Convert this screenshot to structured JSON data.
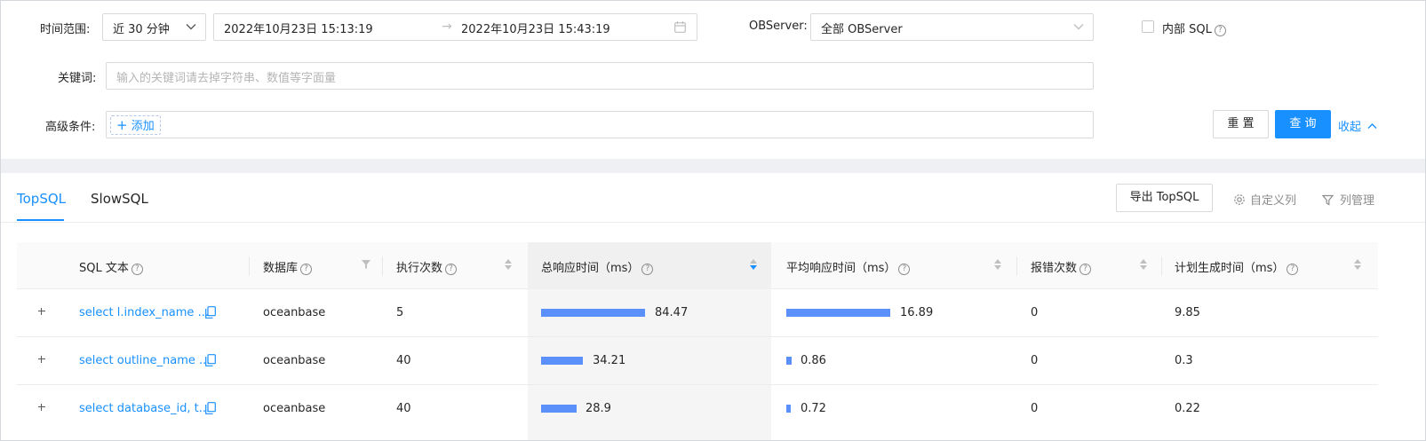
{
  "filters": {
    "time_range_label": "时间范围:",
    "time_range_value": "近 30 分钟",
    "start_time": "2022年10月23日 15:13:19",
    "end_time": "2022年10月23日 15:43:19",
    "observer_label": "OBServer:",
    "observer_value": "全部 OBServer",
    "internal_sql_label": "内部 SQL",
    "keyword_label": "关键词:",
    "keyword_placeholder": "输入的关键词请去掉字符串、数值等字面量",
    "advanced_label": "高级条件:",
    "add_label": "添加",
    "reset_label": "重 置",
    "query_label": "查 询",
    "collapse_label": "收起"
  },
  "tabs": [
    {
      "label": "TopSQL",
      "active": true
    },
    {
      "label": "SlowSQL",
      "active": false
    }
  ],
  "toolbar": {
    "export_label": "导出 TopSQL",
    "custom_columns_label": "自定义列",
    "column_manage_label": "列管理"
  },
  "table": {
    "columns": [
      "SQL 文本",
      "数据库",
      "执行次数",
      "总响应时间（ms）",
      "平均响应时间（ms）",
      "报错次数",
      "计划生成时间（ms）"
    ],
    "rows": [
      {
        "sql": "select l.index_name ...",
        "db": "oceanbase",
        "exec_count": "5",
        "total_rt": "84.47",
        "avg_rt": "16.89",
        "errors": "0",
        "plan_time": "9.85"
      },
      {
        "sql": "select outline_name ...",
        "db": "oceanbase",
        "exec_count": "40",
        "total_rt": "34.21",
        "avg_rt": "0.86",
        "errors": "0",
        "plan_time": "0.3"
      },
      {
        "sql": "select database_id, t...",
        "db": "oceanbase",
        "exec_count": "40",
        "total_rt": "28.9",
        "avg_rt": "0.72",
        "errors": "0",
        "plan_time": "0.22"
      }
    ]
  },
  "colors": {
    "accent": "#1890ff",
    "bar": "#5b8ff9"
  }
}
